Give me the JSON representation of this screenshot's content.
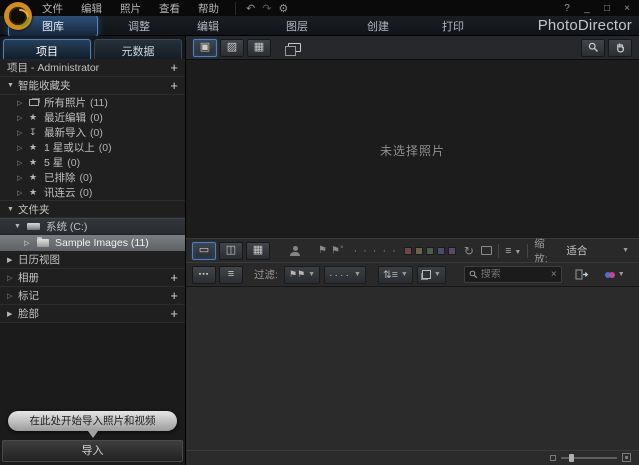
{
  "titlebar": {
    "menus": [
      "文件",
      "编辑",
      "照片",
      "查看",
      "帮助"
    ],
    "window_controls": {
      "help": "?",
      "minimize": "_",
      "maximize": "□",
      "close": "×"
    }
  },
  "tabbar": {
    "tabs": [
      "图库",
      "调整",
      "编辑",
      "图层",
      "创建",
      "打印"
    ],
    "active_tab": "图库",
    "brand": "PhotoDirector"
  },
  "left_panel": {
    "tabs": {
      "project": "项目",
      "metadata": "元数据"
    },
    "project_row": {
      "label": "项目 - Administrator",
      "add": "+"
    },
    "smart_header": {
      "label": "智能收藏夹",
      "add": "+"
    },
    "smart_items": [
      {
        "label": "所有照片",
        "count": "(11)",
        "icon": "photos-stack-icon"
      },
      {
        "label": "最近编辑",
        "count": "(0)",
        "icon": "magic-wand-icon"
      },
      {
        "label": "最新导入",
        "count": "(0)",
        "icon": "import-arrow-icon"
      },
      {
        "label": "1 星或以上",
        "count": "(0)",
        "icon": "star-icon"
      },
      {
        "label": "5 星",
        "count": "(0)",
        "icon": "star-icon"
      },
      {
        "label": "已排除",
        "count": "(0)",
        "icon": "magic-wand-icon"
      },
      {
        "label": "讯连云",
        "count": "(0)",
        "icon": "cloud-icon"
      }
    ],
    "folders_header": {
      "label": "文件夹"
    },
    "drive_row": {
      "label": "系统 (C:)"
    },
    "folder_row": {
      "label": "Sample Images (11)"
    },
    "calendar_row": {
      "label": "日历视图"
    },
    "albums_row": {
      "label": "相册",
      "add": "+"
    },
    "tags_row": {
      "label": "标记",
      "add": "+"
    },
    "faces_row": {
      "label": "脸部",
      "add": "+"
    },
    "import_tooltip": "在此处开始导入照片和视频",
    "import_button": "导入"
  },
  "viewer": {
    "empty_message": "未选择照片"
  },
  "status_toolbar": {
    "zoom_label": "缩放:",
    "zoom_value": "适合"
  },
  "filter_toolbar": {
    "filter_label": "过滤:",
    "search_placeholder": "搜索"
  },
  "colors": {
    "accent_blue": "#4f7fb5",
    "selection_gray": "#6e7275",
    "brand_orange": "#d08c1c",
    "label_chips": [
      "#714646",
      "#6e6246",
      "#4c5a4c",
      "#46506e",
      "#5e4668"
    ],
    "share_dots": [
      "#4a6fd0",
      "#c2498e"
    ]
  }
}
